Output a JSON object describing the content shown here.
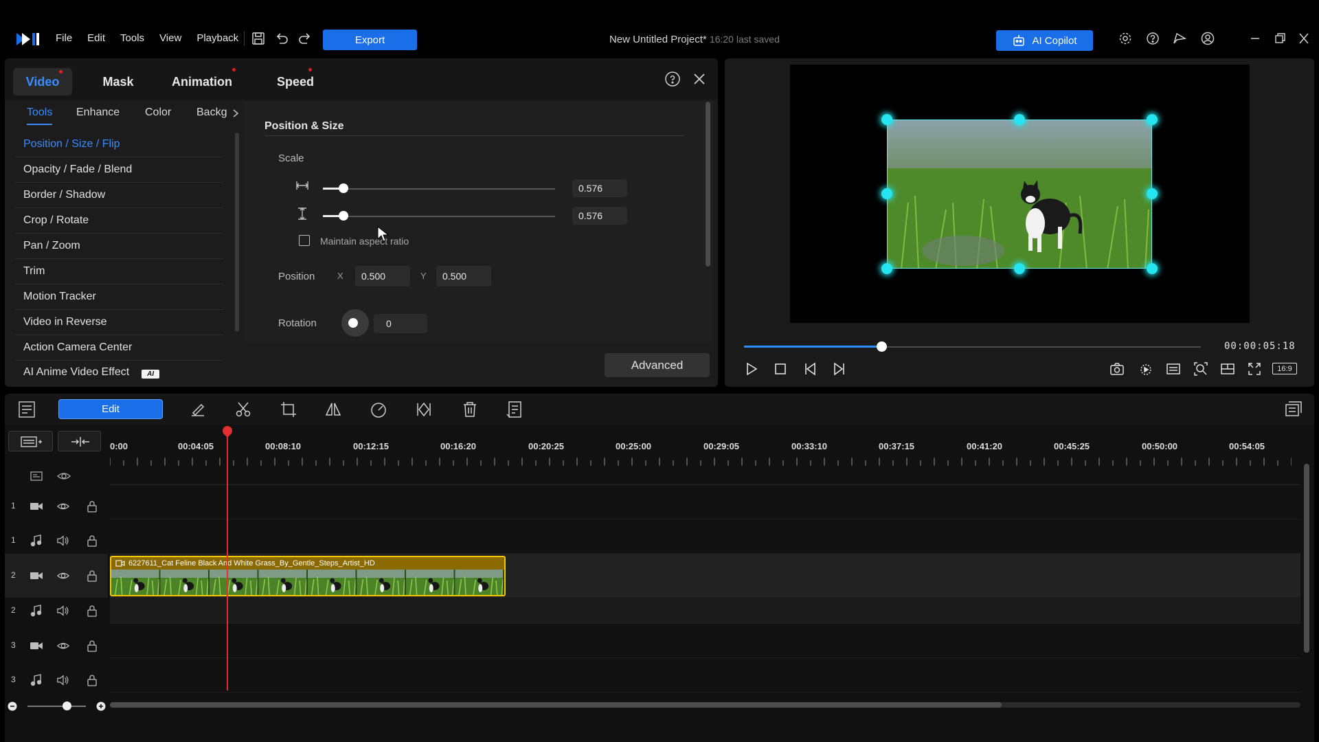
{
  "menu": [
    "File",
    "Edit",
    "Tools",
    "View",
    "Playback"
  ],
  "export_label": "Export",
  "project": {
    "title": "New Untitled Project*",
    "saved": "16:20 last saved"
  },
  "copilot_label": "AI Copilot",
  "panel": {
    "tabs": [
      "Video",
      "Mask",
      "Animation",
      "Speed"
    ],
    "sub_tabs": [
      "Tools",
      "Enhance",
      "Color",
      "Backg"
    ],
    "tools": [
      "Position / Size / Flip",
      "Opacity / Fade / Blend",
      "Border / Shadow",
      "Crop / Rotate",
      "Pan / Zoom",
      "Trim",
      "Motion Tracker",
      "Video in Reverse",
      "Action Camera Center",
      "AI Anime Video Effect"
    ],
    "ai_badge": "AI",
    "section_title": "Position & Size",
    "scale_label": "Scale",
    "scale_w": "0.576",
    "scale_h": "0.576",
    "scale_level": 0.09,
    "maintain_label": "Maintain aspect ratio",
    "position_label": "Position",
    "x_label": "X",
    "y_label": "Y",
    "pos_x": "0.500",
    "pos_y": "0.500",
    "rotation_label": "Rotation",
    "rotation": "0",
    "advanced_label": "Advanced"
  },
  "preview": {
    "timecode": "00:00:05:18",
    "progress": 0.3,
    "aspect_label": "16:9"
  },
  "timeline": {
    "edit_label": "Edit",
    "ruler": [
      "0:00",
      "00:04:05",
      "00:08:10",
      "00:12:15",
      "00:16:20",
      "00:20:25",
      "00:25:00",
      "00:29:05",
      "00:33:10",
      "00:37:15",
      "00:41:20",
      "00:45:25",
      "00:50:00",
      "00:54:05"
    ],
    "tracks": [
      "1",
      "1",
      "2",
      "2",
      "3",
      "3"
    ],
    "clip_name": "6227611_Cat Feline Black And White Grass_By_Gentle_Steps_Artist_HD"
  },
  "colors": {
    "accent": "#1a6fe8",
    "handle": "#25e5f0",
    "clip_border": "#f7c600",
    "playhead": "#e03030"
  }
}
